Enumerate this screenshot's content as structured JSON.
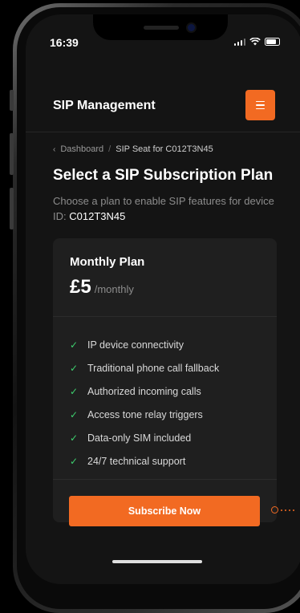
{
  "status_bar": {
    "time": "16:39"
  },
  "header": {
    "title": "SIP Management",
    "menu_icon": "hamburger-menu-icon",
    "accent_color": "#f26a22"
  },
  "breadcrumb": {
    "back_icon": "chevron-left-icon",
    "parent": "Dashboard",
    "separator": "/",
    "current": "SIP Seat for C012T3N45"
  },
  "page": {
    "title": "Select a SIP Subscription Plan",
    "subtitle": "Choose a plan to enable SIP features for device ID:",
    "device_id": "C012T3N45"
  },
  "plan": {
    "name": "Monthly Plan",
    "price": "£5",
    "period": "/monthly",
    "features": [
      "IP device connectivity",
      "Traditional phone call fallback",
      "Authorized incoming calls",
      "Access tone relay triggers",
      "Data-only SIM included",
      "24/7 technical support"
    ],
    "check_color": "#3ecf6e",
    "cta_label": "Subscribe Now"
  }
}
